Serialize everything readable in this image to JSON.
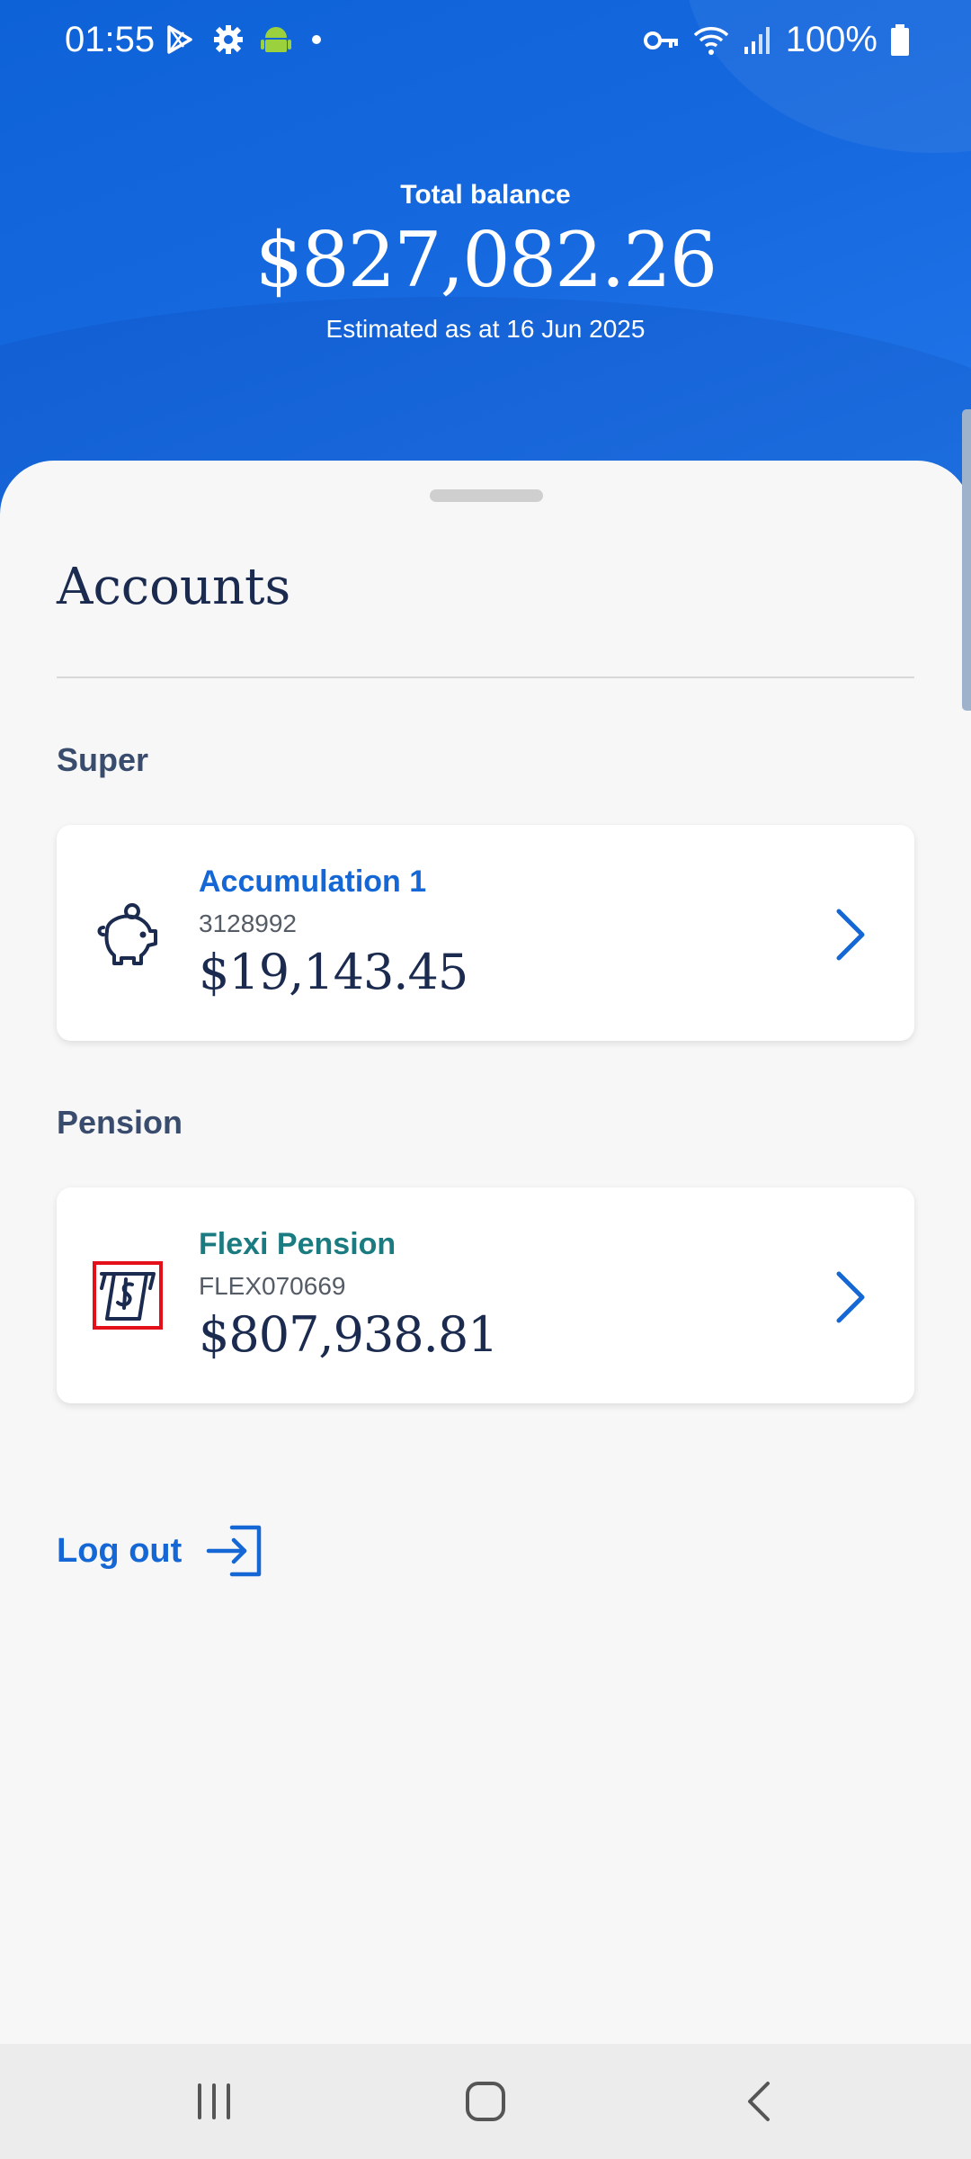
{
  "status_bar": {
    "time": "01:55",
    "left_icons": [
      "play-store-icon",
      "settings-gear-icon",
      "android-icon",
      "dot-icon"
    ],
    "right_icons": [
      "vpn-key-icon",
      "wifi-icon",
      "signal-icon",
      "battery-icon"
    ],
    "battery": "100%"
  },
  "header": {
    "label": "Total balance",
    "amount": "$827,082.26",
    "subtitle": "Estimated as at 16 Jun 2025"
  },
  "accounts": {
    "title": "Accounts",
    "sections": [
      {
        "label": "Super",
        "card": {
          "icon": "piggy-bank-icon",
          "name": "Accumulation 1",
          "number": "3128992",
          "amount": "$19,143.45",
          "name_color": "#1467d4"
        }
      },
      {
        "label": "Pension",
        "card": {
          "icon": "pension-payment-icon",
          "name": "Flexi Pension",
          "number": "FLEX070669",
          "amount": "$807,938.81",
          "name_color": "#1a7b80"
        }
      }
    ]
  },
  "logout": {
    "label": "Log out",
    "icon": "logout-icon"
  },
  "nav": {
    "items": [
      "recent-apps-icon",
      "home-icon",
      "back-icon"
    ]
  },
  "colors": {
    "brand_blue": "#1467d4",
    "navy": "#1b2a4f",
    "highlight": "#e3101a"
  }
}
